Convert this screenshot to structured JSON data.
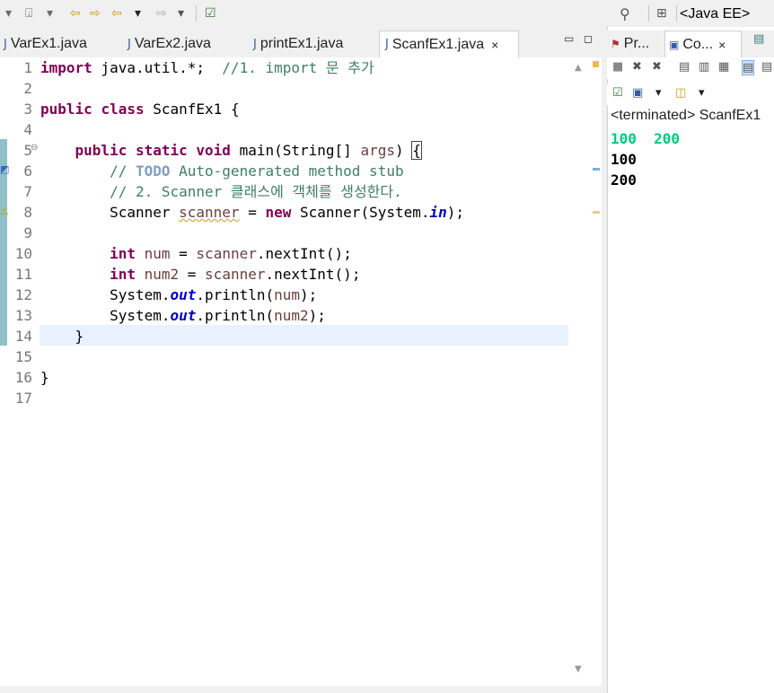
{
  "toolbar": {
    "perspective_label": "<Java EE>",
    "icons": [
      "dropdown-icon",
      "pin-icon",
      "back-edit-icon",
      "forward-edit-icon",
      "back-icon",
      "forward-icon",
      "new-task-icon",
      "search-icon",
      "open-perspective-icon"
    ]
  },
  "editor_tabs": [
    {
      "label": "VarEx1.java"
    },
    {
      "label": "VarEx2.java"
    },
    {
      "label": "printEx1.java"
    },
    {
      "label": "ScanfEx1.java",
      "close": "×"
    }
  ],
  "editor": {
    "line_numbers": [
      "1",
      "2",
      "3",
      "4",
      "5",
      "6",
      "7",
      "8",
      "9",
      "10",
      "11",
      "12",
      "13",
      "14",
      "15",
      "16",
      "17"
    ],
    "fold_marker": "⊖",
    "lines": {
      "l1": {
        "kw": "import",
        "text": " java.util.*;  ",
        "comment": "//1. import 문 추가"
      },
      "l3": {
        "kw1": "public",
        "kw2": "class",
        "text": " ScanfEx1 {"
      },
      "l5": {
        "kw1": "public",
        "kw2": "static",
        "kw3": "void",
        "text": " main(String[] ",
        "var": "args",
        "text2": ") ",
        "brace": "{"
      },
      "l6": {
        "c1": "// ",
        "todo": "TODO",
        "c2": " Auto-generated method stub"
      },
      "l7": {
        "comment": "// 2. Scanner 클래스에 객체를 생성한다."
      },
      "l8": {
        "t1": "Scanner ",
        "var": "scanner",
        "t2": " = ",
        "kw": "new",
        "t3": " Scanner(System.",
        "fld": "in",
        "t4": ");"
      },
      "l10": {
        "kw": "int",
        "sp": " ",
        "var": "num",
        "t1": " = ",
        "var2": "scanner",
        "t2": ".nextInt();"
      },
      "l11": {
        "kw": "int",
        "sp": " ",
        "var": "num2",
        "t1": " = ",
        "var2": "scanner",
        "t2": ".nextInt();"
      },
      "l12": {
        "t1": "System.",
        "fld": "out",
        "t2": ".println(",
        "var": "num",
        "t3": ");"
      },
      "l13": {
        "t1": "System.",
        "fld": "out",
        "t2": ".println(",
        "var": "num2",
        "t3": ");"
      },
      "l14": {
        "text": "}"
      },
      "l16": {
        "text": "}"
      }
    }
  },
  "right_panel": {
    "tabs": [
      {
        "label": "Pr..."
      },
      {
        "label": "Co...",
        "close": "×"
      }
    ],
    "console": {
      "status": "<terminated> ScanfEx1",
      "input_line": "100  200",
      "output": [
        "100",
        "200"
      ],
      "input_color": "#00c87d"
    }
  },
  "colors": {
    "keyword": "#7f0055",
    "comment": "#3f7f5f",
    "field": "#0000c0",
    "local_var": "#6a3e3e",
    "current_line": "#e8f2fe"
  }
}
